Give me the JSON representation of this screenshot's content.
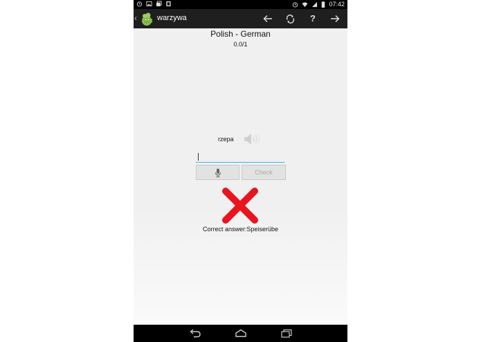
{
  "status_bar": {
    "time": "07:42",
    "left_icons": [
      "alarm-icon",
      "image-icon",
      "gallery-icon",
      "download-icon"
    ],
    "right_icons": [
      "alarm-icon",
      "wifi-icon",
      "signal-icon",
      "battery-icon"
    ]
  },
  "action_bar": {
    "title": "warzywa",
    "buttons": [
      "back-arrow-icon",
      "refresh-icon",
      "help-icon",
      "forward-arrow-icon"
    ],
    "help_label": "?"
  },
  "quiz": {
    "language_pair": "Polish - German",
    "score": "0.0/1",
    "word": "rzepa",
    "answer_value": "",
    "check_label": "Check",
    "correct_answer": "Correct answer:Speiserübe",
    "wrong_color": "#e8141e"
  },
  "nav_bar": {
    "buttons": [
      "back-icon",
      "home-icon",
      "recents-icon"
    ]
  }
}
